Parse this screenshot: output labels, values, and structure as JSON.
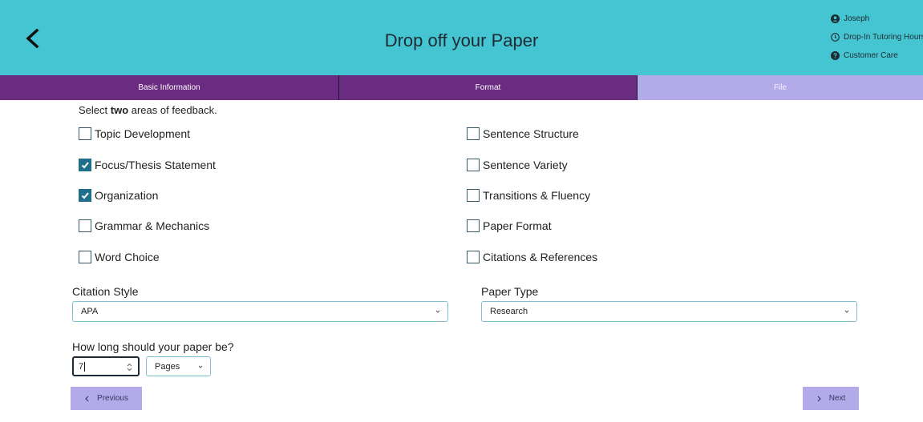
{
  "header": {
    "title": "Drop off your Paper",
    "links": [
      {
        "label": "Joseph",
        "icon": "user-circle-icon"
      },
      {
        "label": "Drop-In Tutoring Hours",
        "icon": "clock-icon"
      },
      {
        "label": "Customer Care",
        "icon": "question-circle-icon"
      }
    ]
  },
  "tabs": [
    {
      "label": "Basic Information"
    },
    {
      "label": "Format"
    },
    {
      "label": "File"
    }
  ],
  "feedback": {
    "prefix": "Select ",
    "emphasis": "two",
    "suffix": " areas of feedback.",
    "options": [
      {
        "label": "Topic Development",
        "checked": false
      },
      {
        "label": "Focus/Thesis Statement",
        "checked": true
      },
      {
        "label": "Organization",
        "checked": true
      },
      {
        "label": "Grammar & Mechanics",
        "checked": false
      },
      {
        "label": "Word Choice",
        "checked": false
      },
      {
        "label": "Sentence Structure",
        "checked": false
      },
      {
        "label": "Sentence Variety",
        "checked": false
      },
      {
        "label": "Transitions & Fluency",
        "checked": false
      },
      {
        "label": "Paper Format",
        "checked": false
      },
      {
        "label": "Citations & References",
        "checked": false
      }
    ]
  },
  "citation": {
    "label": "Citation Style",
    "value": "APA"
  },
  "paper_type": {
    "label": "Paper Type",
    "value": "Research"
  },
  "length": {
    "label": "How long should your paper be?",
    "value": "7",
    "unit": "Pages"
  },
  "nav": {
    "previous": "Previous",
    "next": "Next"
  },
  "colors": {
    "header": "#45c5d1",
    "tab": "#6a2c80",
    "active_tab": "#b3aaea",
    "checkbox": "#1f6f8b"
  }
}
